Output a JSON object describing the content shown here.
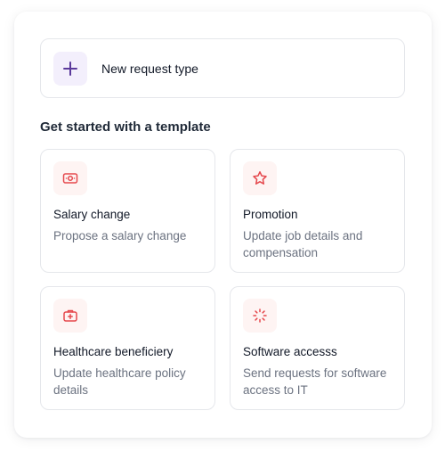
{
  "new_request": {
    "label": "New request type",
    "icon": "plus-icon",
    "icon_color": "#5b3a9b",
    "icon_bg": "#f3effc"
  },
  "section_title": "Get started with a template",
  "accent_color": "#e5484d",
  "templates": [
    {
      "title": "Salary change",
      "description": "Propose a salary change",
      "icon": "money-icon"
    },
    {
      "title": "Promotion",
      "description": "Update job details and compensation",
      "icon": "star-icon"
    },
    {
      "title": "Healthcare beneficiery",
      "description": "Update healthcare policy details",
      "icon": "medical-kit-icon"
    },
    {
      "title": "Software accesss",
      "description": "Send requests for software access to IT",
      "icon": "loader-icon"
    }
  ]
}
